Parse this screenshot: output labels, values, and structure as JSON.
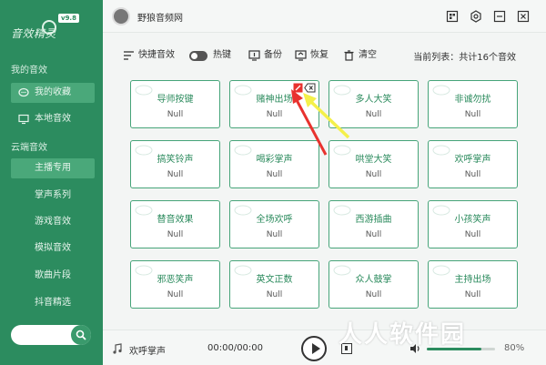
{
  "app": {
    "title": "野狼音频网",
    "logo_text": "音效精灵",
    "logo_badge": "v9.8"
  },
  "sidebar": {
    "my_sounds_title": "我的音效",
    "my_items": [
      {
        "label": "我的收藏",
        "icon": "chat-bubble-icon",
        "active": true
      },
      {
        "label": "本地音效",
        "icon": "monitor-icon",
        "active": false
      }
    ],
    "cloud_title": "云端音效",
    "cloud_items": [
      {
        "label": "主播专用",
        "active": true
      },
      {
        "label": "掌声系列"
      },
      {
        "label": "游戏音效"
      },
      {
        "label": "模拟音效"
      },
      {
        "label": "歌曲片段"
      },
      {
        "label": "抖音精选"
      }
    ]
  },
  "toolbar": {
    "hotkey_panel_label": "快捷音效",
    "hotkey_label": "热键",
    "backup_label": "备份",
    "restore_label": "恢复",
    "clear_label": "清空",
    "list_info": "当前列表：共计16个音效"
  },
  "cards": [
    {
      "name": "导师按键",
      "value": "Null"
    },
    {
      "name": "赌神出场",
      "value": "Null",
      "show_actions": true
    },
    {
      "name": "多人大笑",
      "value": "Null"
    },
    {
      "name": "非诚勿扰",
      "value": "Null"
    },
    {
      "name": "搞笑铃声",
      "value": "Null"
    },
    {
      "name": "喝彩掌声",
      "value": "Null"
    },
    {
      "name": "哄堂大笑",
      "value": "Null"
    },
    {
      "name": "欢呼掌声",
      "value": "Null"
    },
    {
      "name": "替音效果",
      "value": "Null"
    },
    {
      "name": "全场欢呼",
      "value": "Null"
    },
    {
      "name": "西游插曲",
      "value": "Null"
    },
    {
      "name": "小孩笑声",
      "value": "Null"
    },
    {
      "name": "邪恶笑声",
      "value": "Null"
    },
    {
      "name": "英文正数",
      "value": "Null"
    },
    {
      "name": "众人鼓掌",
      "value": "Null"
    },
    {
      "name": "主持出场",
      "value": "Null"
    }
  ],
  "player": {
    "now_playing": "欢呼掌声",
    "time": "00:00/00:00",
    "volume_text": "80%",
    "volume_level": 0.8
  },
  "watermark": "人人软件园",
  "colors": {
    "brand_green": "#2c8c5f",
    "card_border": "#46a479",
    "arrow_red": "#e8322e",
    "arrow_yellow": "#f4f04a"
  }
}
